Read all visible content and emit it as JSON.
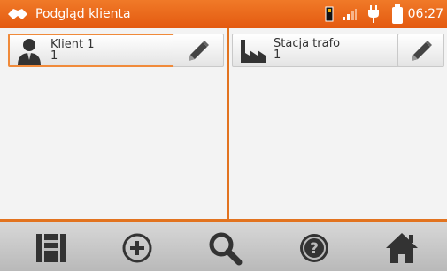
{
  "header": {
    "title": "Podgląd klienta",
    "time": "06:27",
    "accent": "#e45a10",
    "icons": [
      "handshake-icon",
      "memory-card-icon",
      "signal-icon",
      "plug-icon",
      "battery-icon"
    ]
  },
  "left_panel": {
    "client_name": "Klient 1",
    "client_number": "1",
    "icon": "person-icon",
    "edit_icon": "pencil-icon"
  },
  "right_panel": {
    "object_name": "Stacja trafo",
    "object_number": "1",
    "icon": "factory-icon",
    "edit_icon": "pencil-icon"
  },
  "toolbar": {
    "buttons": [
      "tree-structure-icon",
      "add-icon",
      "search-icon",
      "help-icon",
      "home-icon"
    ]
  }
}
